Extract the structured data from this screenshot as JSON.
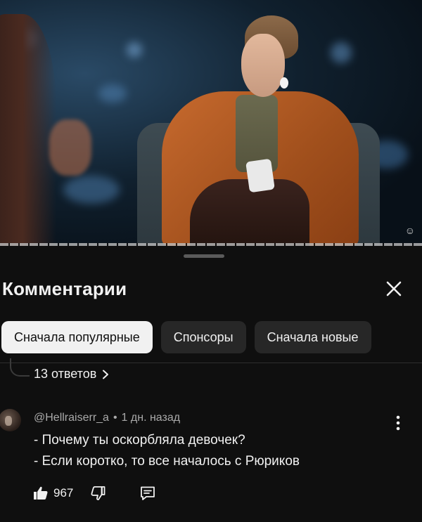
{
  "video": {
    "description_icon": "video-frame"
  },
  "comments_panel": {
    "title": "Комментарии",
    "close_icon": "close-icon",
    "chips": [
      {
        "label": "Сначала популярные",
        "active": true
      },
      {
        "label": "Спонсоры",
        "active": false
      },
      {
        "label": "Сначала новые",
        "active": false
      }
    ],
    "replies_link": "13 ответов",
    "comment": {
      "author": "@Hellraiserr_a",
      "separator": "•",
      "time": "1 дн. назад",
      "lines": [
        "- Почему ты оскорбляла девочек?",
        "- Если коротко, то все началось с Рюриков"
      ],
      "likes": "967"
    }
  },
  "colors": {
    "background": "#0f0f0f",
    "chip_bg": "#272727",
    "chip_active_bg": "#f1f1f1",
    "text_primary": "#f1f1f1",
    "text_secondary": "#aaaaaa"
  }
}
